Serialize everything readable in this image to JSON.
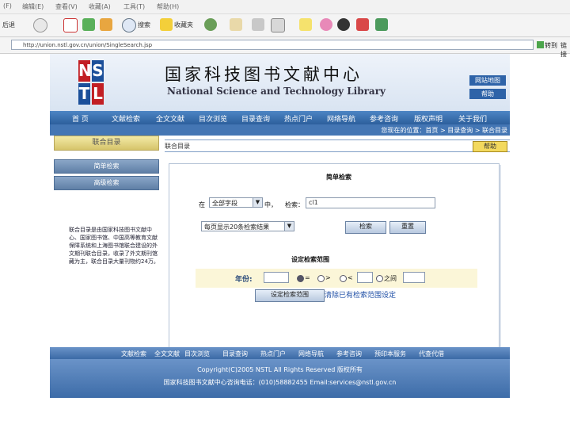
{
  "browser": {
    "menu": [
      "(F)",
      "编辑(E)",
      "查看(V)",
      "收藏(A)",
      "工具(T)",
      "帮助(H)"
    ],
    "toolbar": {
      "back_label": "后退",
      "search_label": "搜索",
      "favorites_label": "收藏夹"
    },
    "address": "http://union.nstl.gov.cn/union/SingleSearch.jsp",
    "go_label": "转到",
    "links_label": "链接"
  },
  "site": {
    "logo_letters": [
      "N",
      "S",
      "T",
      "L"
    ],
    "title_cn": "国家科技图书文献中心",
    "title_en": "National Science and Technology Library",
    "corner_buttons": [
      "网站地图",
      "帮助"
    ],
    "nav_items": [
      "首 页",
      "文献检索",
      "全文文献",
      "目次浏览",
      "目录查询",
      "热点门户",
      "网络导航",
      "参考咨询",
      "版权声明",
      "关于我们"
    ],
    "location": "您现在的位置：首页 > 目录查询 > 联合目录"
  },
  "sidebar": {
    "active": "联合目录",
    "items": [
      "简单检索",
      "高级检索"
    ],
    "description": "联合目录是由国家科技图书文献中心、国家图书馆、中国高等教育文献保障系统和上海图书馆联合建设的外文期刊联合目录，收录了外文期刊馆藏为主，联合目录大量刊物约24万。"
  },
  "crumb": "联合目录",
  "help_button": "帮助",
  "form": {
    "title": "简单检索",
    "in_label": "在",
    "field_select": "全部字段",
    "in_suffix": "中，",
    "search_label": "检索：",
    "search_value": "cl1",
    "per_page_select": "每页显示20条检索结果",
    "search_button": "检索",
    "reset_button": "重置",
    "range_title": "设定检索范围",
    "year_label": "年份:",
    "radio_options": [
      "=",
      ">",
      "<",
      "之间"
    ],
    "radio_selected": 0,
    "set_range_button": "设定检索范围",
    "clear_link": "清除已有检索范围设定"
  },
  "footer": {
    "nav": [
      "文献检索",
      "全文文献",
      "目次浏览",
      "目录查询",
      "热点门户",
      "网络导航",
      "参考咨询",
      "预印本服务",
      "代查代借"
    ],
    "copyright": "Copyright(C)2005 NSTL All Rights Reserved 版权所有",
    "contact": "国家科技图书文献中心咨询电话：(010)58882455  Email:services@nstl.gov.cn"
  }
}
